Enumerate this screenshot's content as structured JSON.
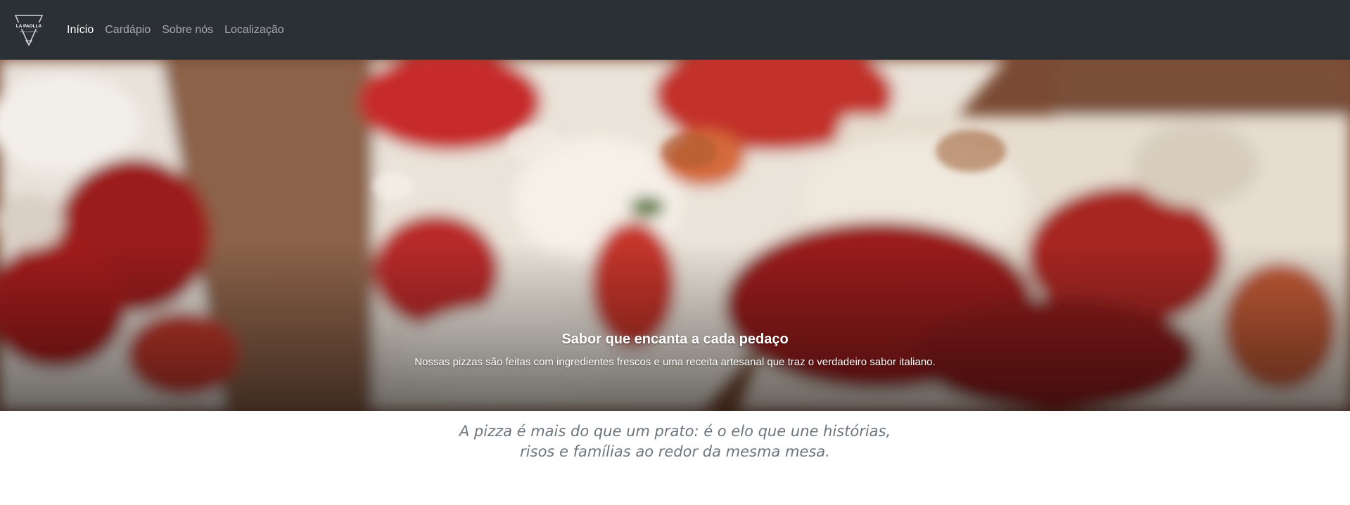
{
  "brand": {
    "logo_text": "LA PAOLLA",
    "logo_tagline": "PIZZA & LANCHES"
  },
  "nav": {
    "items": [
      {
        "label": "Início",
        "active": true
      },
      {
        "label": "Cardápio",
        "active": false
      },
      {
        "label": "Sobre nós",
        "active": false
      },
      {
        "label": "Localização",
        "active": false
      }
    ]
  },
  "hero": {
    "title": "Sabor que encanta a cada pedaço",
    "subtitle": "Nossas pizzas são feitas com ingredientes frescos e uma receita artesanal que traz o verdadeiro sabor italiano."
  },
  "quote": {
    "line1": "A pizza é mais do que um prato: é o elo que une histórias,",
    "line2": "risos e famílias ao redor da mesma mesa."
  },
  "colors": {
    "navbar": "#2b3035",
    "nav_active": "#ffffff",
    "nav_inactive": "rgba(255,255,255,0.58)",
    "quote_text": "#6c757d"
  }
}
